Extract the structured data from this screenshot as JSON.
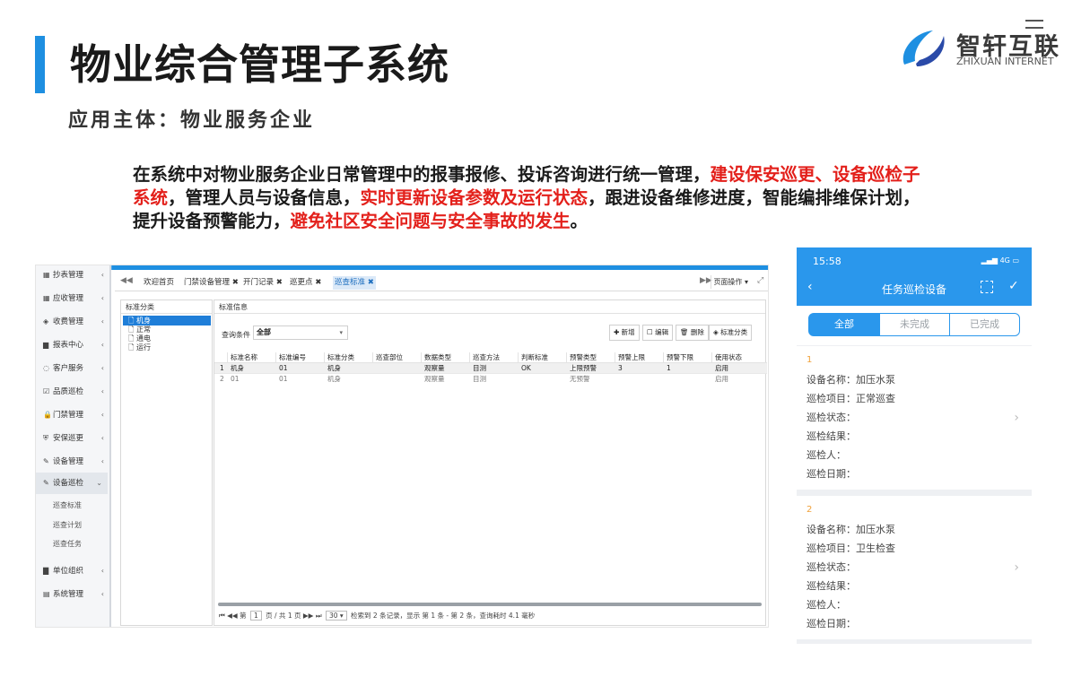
{
  "slide": {
    "title": "物业综合管理子系统",
    "subtitle": "应用主体：物业服务企业",
    "logo_name": "智轩互联",
    "logo_en": "ZHIXUAN INTERNET",
    "desc_parts": [
      {
        "text": "在系统中对物业服务企业日常管理中的报事报修、投诉咨询进行统一管理，",
        "highlight": false
      },
      {
        "text": "建设保安巡更、设备巡检子系统",
        "highlight": true
      },
      {
        "text": "，管理人员与设备信息，",
        "highlight": false
      },
      {
        "text": "实时更新设备参数及运行状态",
        "highlight": true
      },
      {
        "text": "，跟进设备维修进度，智能编排维保计划，提升设备预警能力，",
        "highlight": false
      },
      {
        "text": "避免社区安全问题与安全事故的发生",
        "highlight": true
      },
      {
        "text": "。",
        "highlight": false
      }
    ],
    "accent_color": "#1e8fe1",
    "highlight_color": "#e3201b"
  },
  "desktop": {
    "sidebar": [
      {
        "icon": "▦",
        "label": "抄表管理"
      },
      {
        "icon": "▦",
        "label": "应收管理"
      },
      {
        "icon": "◈",
        "label": "收费管理"
      },
      {
        "icon": "▆",
        "label": "报表中心"
      },
      {
        "icon": "◌",
        "label": "客户服务"
      },
      {
        "icon": "☑",
        "label": "品质巡检"
      },
      {
        "icon": "🔒",
        "label": "门禁管理"
      },
      {
        "icon": "⛨",
        "label": "安保巡更"
      },
      {
        "icon": "✎",
        "label": "设备管理"
      },
      {
        "icon": "✎",
        "label": "设备巡检"
      },
      {
        "icon": "▇",
        "label": "单位组织"
      },
      {
        "icon": "▤",
        "label": "系统管理"
      }
    ],
    "sidebar_sub": [
      "巡查标准",
      "巡查计划",
      "巡查任务"
    ],
    "tabs": [
      "欢迎首页",
      "门禁设备管理",
      "开门记录",
      "巡更点",
      "巡查标准"
    ],
    "page_ops": "页面操作",
    "left_panel_title": "标准分类",
    "tree": [
      "机身",
      "正常",
      "通电",
      "运行"
    ],
    "right_panel_title": "标准信息",
    "query_label": "查询条件",
    "query_value": "全部",
    "buttons": [
      "新增",
      "编辑",
      "删除",
      "标准分类"
    ],
    "columns": [
      "标准名称",
      "标准编号",
      "标准分类",
      "巡查部位",
      "数据类型",
      "巡查方法",
      "判断标准",
      "预警类型",
      "预警上限",
      "预警下限",
      "使用状态"
    ],
    "rows": [
      [
        "1",
        "机身",
        "01",
        "机身",
        "",
        "观察量",
        "目测",
        "OK",
        "上限预警",
        "3",
        "1",
        "启用"
      ],
      [
        "2",
        "01",
        "01",
        "机身",
        "",
        "观察量",
        "目测",
        "",
        "无预警",
        "",
        "",
        "启用"
      ]
    ],
    "pager": {
      "page_label": "第",
      "page_num": "1",
      "page_total": "页 / 共 1 页",
      "size": "30",
      "summary": "检索到 2 条记录，显示 第 1 条 - 第 2 条，查询耗时 4.1 毫秒"
    }
  },
  "mobile": {
    "time": "15:58",
    "status": "4G",
    "title": "任务巡检设备",
    "segments": [
      "全部",
      "未完成",
      "已完成"
    ],
    "cards": [
      {
        "idx": "1",
        "lines": [
          "设备名称：加压水泵",
          "巡检项目：正常巡查",
          "巡检状态：",
          "巡检结果：",
          "巡检人：",
          "巡检日期："
        ]
      },
      {
        "idx": "2",
        "lines": [
          "设备名称：加压水泵",
          "巡检项目：卫生检查",
          "巡检状态：",
          "巡检结果：",
          "巡检人：",
          "巡检日期："
        ]
      }
    ],
    "accent_color": "#2a97ec"
  }
}
